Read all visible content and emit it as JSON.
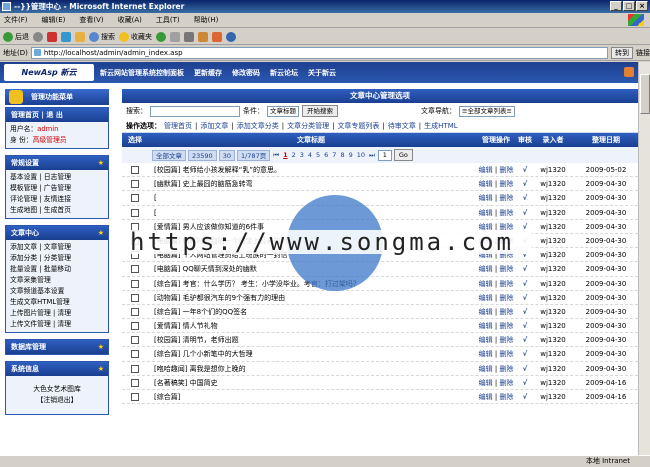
{
  "window": {
    "title": "--}}管理中心 - Microsoft Internet Explorer"
  },
  "menubar": [
    "文件(F)",
    "编辑(E)",
    "查看(V)",
    "收藏(A)",
    "工具(T)",
    "帮助(H)"
  ],
  "toolbar": {
    "back": "后退",
    "search": "搜索",
    "favorites": "收藏夹"
  },
  "address": {
    "label": "地址(D)",
    "url": "http://localhost/admin/admin_index.asp",
    "go": "转到",
    "links": "链接"
  },
  "status": {
    "text": "",
    "zone": "本地 Intranet"
  },
  "topnav": {
    "logo": "NewAsp 新云",
    "items": [
      "新云网站管理系统控制面板",
      "更新缓存",
      "修改密码",
      "新云论坛",
      "关于新云"
    ]
  },
  "sidebar": {
    "panel_title": "管理功能菜单",
    "home": {
      "title": "管理首页 | 退 出",
      "user_label": "用户名：",
      "user_value": "admin",
      "role_label": "身 份：",
      "role_value": "高级管理员"
    },
    "settings": {
      "title": "常规设置",
      "items": [
        "基本设置 | 日志管理",
        "模板管理 | 广告管理",
        "评论管理 | 友情连接",
        "生成地图 | 生成首页"
      ]
    },
    "article": {
      "title": "文章中心",
      "items": [
        "添加文章 | 文章管理",
        "添加分类 | 分类管理",
        "批量设置 | 批量移动",
        "文章采集管理",
        "文章频道基本设置",
        "生成文章HTML管理",
        "上传图片管理 | 清理",
        "上传文件管理 | 清理"
      ]
    },
    "database": {
      "title": "数据库管理"
    },
    "sysinfo": {
      "title": "系统信息",
      "items": [
        "大色女艺术图库",
        "【注销退出】"
      ]
    }
  },
  "main": {
    "title": "文章中心管理选项",
    "search": {
      "label": "搜索：",
      "value": "",
      "cond_label": "条件：",
      "cond_value": "文章标题",
      "button": "开始搜索",
      "nav_label": "文章导航：",
      "nav_value": "≡全部文章列表≡"
    },
    "ops_label": "操作选项：",
    "ops": [
      "管理首页",
      "添加文章",
      "添加文章分类",
      "文章分类管理",
      "文章专题列表",
      "待审文章",
      "生成HTML"
    ],
    "columns": [
      "选择",
      "文章标题",
      "管理操作",
      "审核",
      "录入者",
      "整理日期"
    ],
    "pager": {
      "all": "全部文章",
      "total": "23590",
      "per": "30",
      "pages": "1/787页",
      "prev": "⏮",
      "numbers": [
        "1",
        "2",
        "3",
        "4",
        "5",
        "6",
        "7",
        "8",
        "9",
        "10"
      ],
      "next": "⏭",
      "goto": "1",
      "go": "Go"
    },
    "row_edit": "编辑",
    "row_delete": "删除",
    "rows": [
      {
        "title": "[校园篇] 老师给小孩发解释“乳”的意思。",
        "audit": "√",
        "author": "wj1320",
        "date": "2009-05-02"
      },
      {
        "title": "[幽默篇] 史上最囧的脑筋急转弯",
        "audit": "√",
        "author": "wj1320",
        "date": "2009-04-30"
      },
      {
        "title": "[",
        "audit": "√",
        "author": "wj1320",
        "date": "2009-04-30"
      },
      {
        "title": "[",
        "audit": "√",
        "author": "wj1320",
        "date": "2009-04-30"
      },
      {
        "title": "[爱情篇] 男人应该做你知道的6件事",
        "audit": "√",
        "author": "wj1320",
        "date": "2009-04-30"
      },
      {
        "title": "[电脑篇] 闲聊时看到的一个阔宝上经典的对话",
        "audit": "√",
        "author": "wj1320",
        "date": "2009-04-30"
      },
      {
        "title": "[电脑篇] 个人网站管理员给上班族的一封信",
        "audit": "√",
        "author": "wj1320",
        "date": "2009-04-30"
      },
      {
        "title": "[电脑篇] QQ聊天情到深处的幽默",
        "audit": "√",
        "author": "wj1320",
        "date": "2009-04-30"
      },
      {
        "title": "[综合篇] 考官：什么学历？ 考生：小学没毕业。考官：打过架吗？",
        "audit": "√",
        "author": "wj1320",
        "date": "2009-04-30"
      },
      {
        "title": "[动物篇] 毛驴都很汽车的9个强有力的理由",
        "audit": "√",
        "author": "wj1320",
        "date": "2009-04-30"
      },
      {
        "title": "[综合篇] 一年8个们的QQ签名",
        "audit": "√",
        "author": "wj1320",
        "date": "2009-04-30"
      },
      {
        "title": "[爱情篇] 情人节礼物",
        "audit": "√",
        "author": "wj1320",
        "date": "2009-04-30"
      },
      {
        "title": "[校园篇] 清明节，老师出题",
        "audit": "√",
        "author": "wj1320",
        "date": "2009-04-30"
      },
      {
        "title": "[综合篇] 几个小新笔中的大哲理",
        "audit": "√",
        "author": "wj1320",
        "date": "2009-04-30"
      },
      {
        "title": "[咆哈趣闻] 离我是想你上晚的",
        "audit": "√",
        "author": "wj1320",
        "date": "2009-04-30"
      },
      {
        "title": "[名著稿笑] 中国简史",
        "audit": "√",
        "author": "wj1320",
        "date": "2009-04-16"
      },
      {
        "title": "[综合篇] ",
        "audit": "√",
        "author": "wj1320",
        "date": "2009-04-16"
      }
    ]
  },
  "watermark": "https://www.songma.com"
}
